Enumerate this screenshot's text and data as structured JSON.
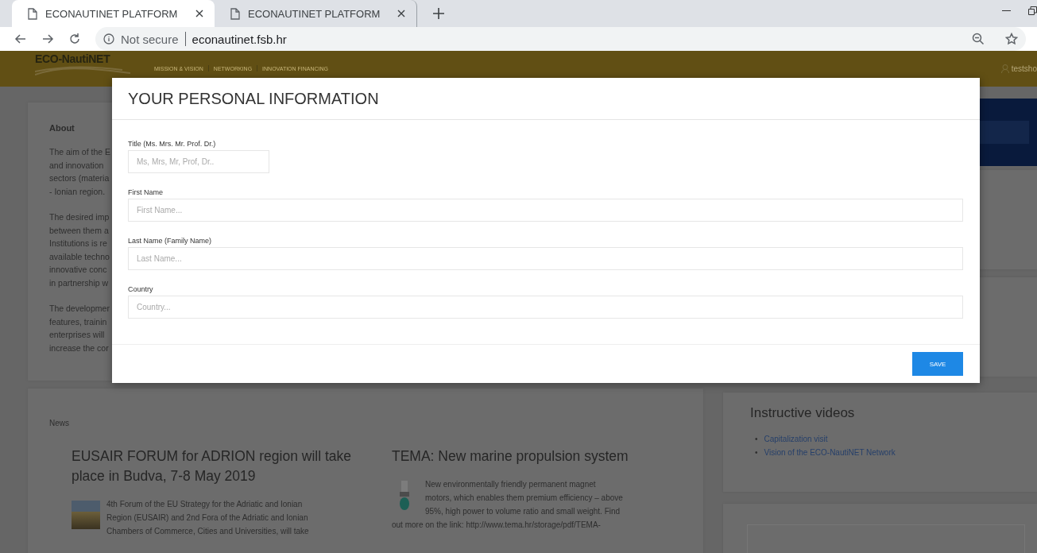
{
  "browser": {
    "tabs": [
      {
        "title": "ECONAUTINET PLATFORM",
        "selected": true
      },
      {
        "title": "ECONAUTINET PLATFORM",
        "selected": false
      }
    ],
    "address": {
      "security": "Not secure",
      "url": "econautinet.fsb.hr"
    }
  },
  "site": {
    "logo": "ECO-NautiNET",
    "nav": [
      "MISSION & VISION",
      "NETWORKING",
      "INNOVATION FINANCING"
    ],
    "user": "testsho"
  },
  "about": {
    "heading": "About",
    "paragraphs": [
      [
        "The aim of the E",
        "and innovation",
        "sectors (materia",
        "- Ionian region."
      ],
      [
        "The desired imp",
        "between them a",
        "Institutions is re",
        "available techno",
        "innovative conc",
        "in partnership w"
      ],
      [
        "The developmer",
        "features, trainin",
        "enterprises will",
        "increase the cor"
      ]
    ]
  },
  "modal": {
    "title": "YOUR PERSONAL INFORMATION",
    "fields": [
      {
        "label": "Title (Ms. Mrs. Mr. Prof. Dr.)",
        "placeholder": "Ms, Mrs, Mr, Prof, Dr..",
        "kind": "short"
      },
      {
        "label": "First Name",
        "placeholder": "First Name...",
        "kind": "full"
      },
      {
        "label": "Last Name (Family Name)",
        "placeholder": "Last Name...",
        "kind": "full"
      },
      {
        "label": "Country",
        "placeholder": "Country...",
        "kind": "full"
      }
    ],
    "button": "SAVE"
  },
  "news": {
    "heading": "News",
    "articles": [
      {
        "kind": "photo",
        "title": [
          "EUSAIR FORUM for ADRION region will take",
          "place in Budva, 7-8 May 2019"
        ],
        "text": [
          "4th Forum of the EU Strategy for the Adriatic and Ionian",
          "Region (EUSAIR) and 2nd Fora of the Adriatic and Ionian",
          "Chambers of Commerce, Cities and Universities, will take"
        ]
      },
      {
        "kind": "motor",
        "title": [
          "TEMA: New marine propulsion system"
        ],
        "text": [
          "New environmentally friendly permanent magnet",
          "motors, which enables them premium efficiency – above",
          "95%, high power to volume ratio and small weight. Find",
          "out more on the link: http://www.tema.hr/storage/pdf/TEMA-"
        ]
      }
    ]
  },
  "videos": {
    "title": "Instructive videos",
    "links": [
      {
        "bullet": "•",
        "text": "Capitalization visit"
      },
      {
        "bullet": "•",
        "text": "Vision of the ECO-NautiNET Network"
      }
    ]
  }
}
